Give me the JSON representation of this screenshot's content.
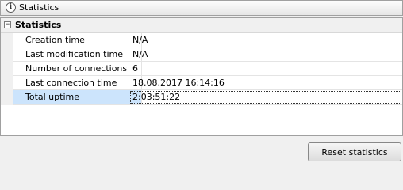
{
  "header": {
    "title": "Statistics",
    "icon": "info-icon"
  },
  "grid": {
    "category": "Statistics",
    "rows": [
      {
        "name": "Creation time",
        "value": "N/A"
      },
      {
        "name": "Last modification time",
        "value": "N/A"
      },
      {
        "name": "Number of connections",
        "value": "6"
      },
      {
        "name": "Last connection time",
        "value": "18.08.2017 16:14:16"
      },
      {
        "name": "Total uptime",
        "value": "2:03:51:22",
        "selected": true
      }
    ]
  },
  "footer": {
    "reset_label": "Reset statistics"
  },
  "colors": {
    "selection": "#cce4fc",
    "border": "#a0a0a0",
    "background": "#f0f0f0"
  }
}
